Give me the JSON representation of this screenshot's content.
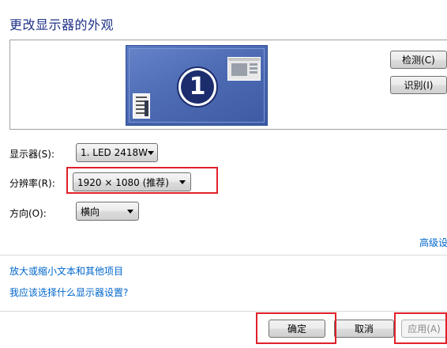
{
  "header": {
    "title": "更改显示器的外观"
  },
  "preview": {
    "monitor_number": "1",
    "detect_label": "检测(C)",
    "identify_label": "识别(I)"
  },
  "fields": {
    "display": {
      "label": "显示器(S):",
      "value": "1. LED 2418W"
    },
    "resolution": {
      "label": "分辨率(R):",
      "value": "1920 × 1080 (推荐)"
    },
    "orientation": {
      "label": "方向(O):",
      "value": "横向"
    }
  },
  "links": {
    "advanced": "高级设",
    "zoom_text": "放大或缩小文本和其他项目",
    "which_settings": "我应该选择什么显示器设置?"
  },
  "footer": {
    "ok_label": "确定",
    "cancel_label": "取消",
    "apply_label": "应用(A)"
  },
  "colors": {
    "title": "#1e3287",
    "link": "#0066cc",
    "highlight_box": "#e0202a",
    "monitor_blue": "#4866ae"
  }
}
